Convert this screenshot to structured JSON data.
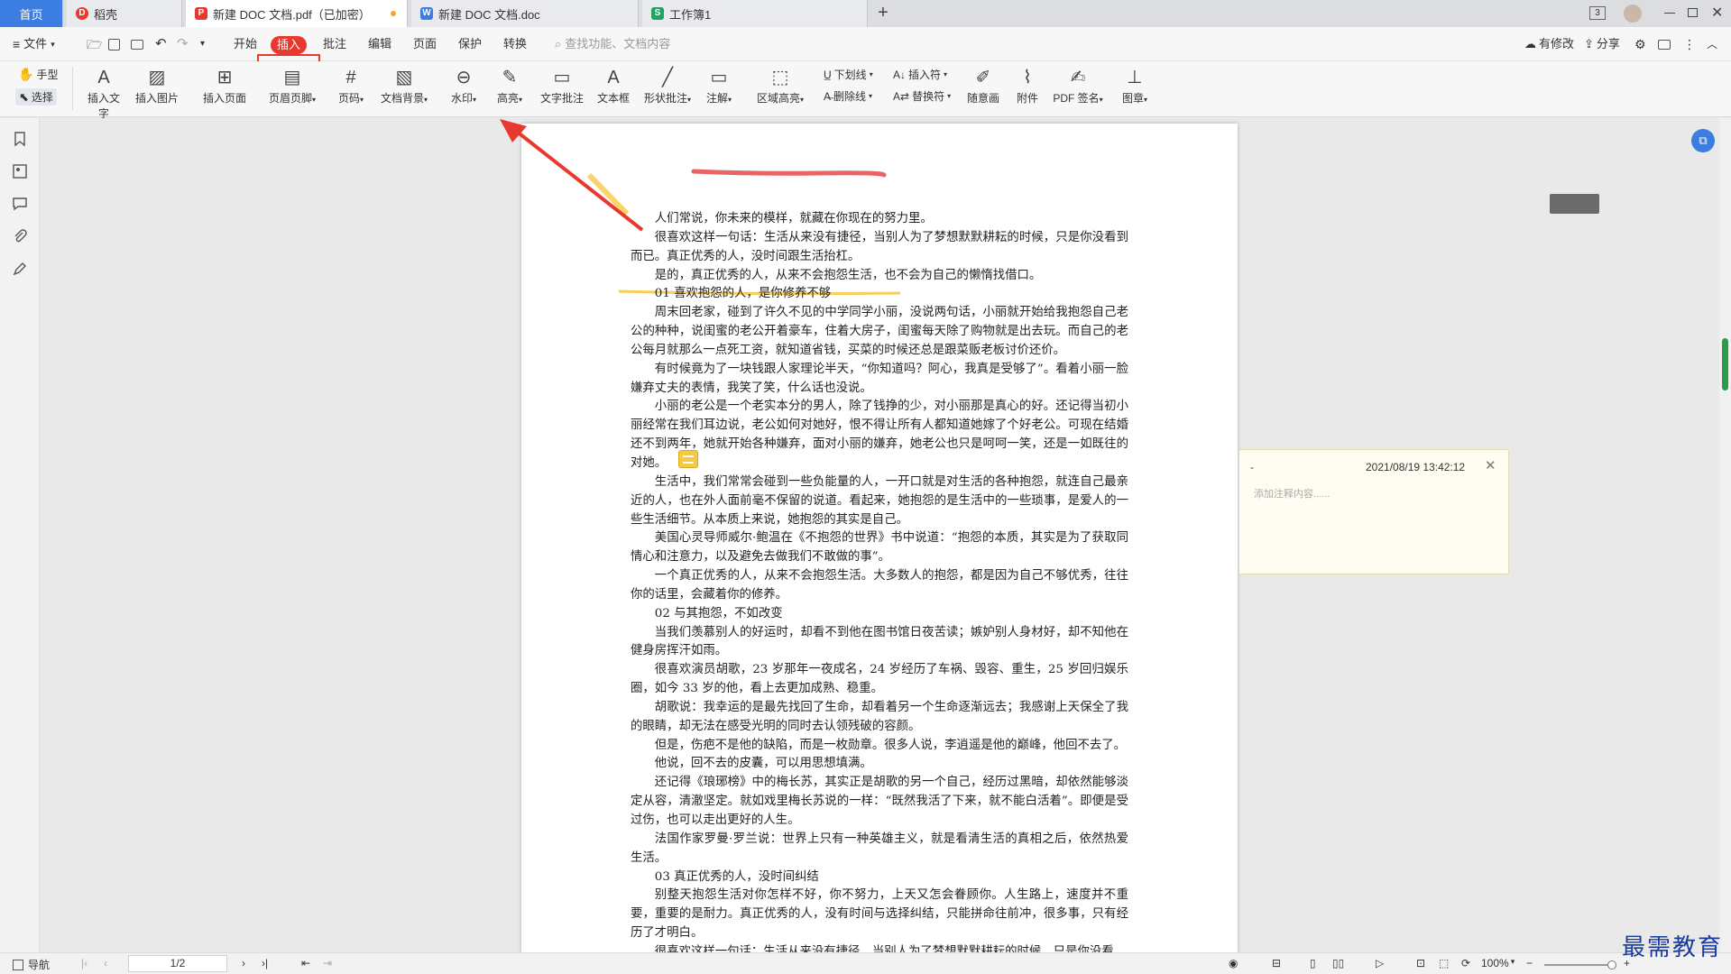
{
  "tabs": [
    {
      "label": "首页",
      "icon": "home-icon"
    },
    {
      "label": "稻壳",
      "icon": "docer-icon"
    },
    {
      "label": "新建 DOC 文档.pdf（已加密）",
      "icon": "pdf-icon"
    },
    {
      "label": "新建 DOC 文档.doc",
      "icon": "word-icon"
    },
    {
      "label": "工作簿1",
      "icon": "sheet-icon"
    }
  ],
  "tabbar": {
    "add_label": "+",
    "page_count": "3"
  },
  "menu": {
    "file": "文件",
    "items": [
      "开始",
      "插入",
      "批注",
      "编辑",
      "页面",
      "保护",
      "转换"
    ],
    "search_placeholder": "查找功能、文档内容",
    "modified": "有修改",
    "share": "分享"
  },
  "toolbar": {
    "hand": "手型",
    "select": "选择",
    "big": [
      "插入文字",
      "插入图片",
      "插入页面",
      "页眉页脚",
      "页码",
      "文档背景",
      "水印",
      "高亮",
      "文字批注",
      "文本框",
      "形状批注",
      "注解",
      "区域高亮"
    ],
    "small_top": [
      "下划线",
      "插入符"
    ],
    "small_bottom": [
      "删除线",
      "替换符"
    ],
    "big2": [
      "随意画",
      "附件",
      "PDF 签名",
      "图章"
    ]
  },
  "document": {
    "paragraphs": [
      {
        "t": "人们常说，你未来的模样，就藏在你现在的努力里。",
        "ind": true
      },
      {
        "t": "很喜欢这样一句话：生活从来没有捷径，当别人为了梦想默默耕耘的时候，只是你没看到而已。真正优秀的人，没时间跟生活抬杠。",
        "ind": true
      },
      {
        "t": "是的，真正优秀的人，从来不会抱怨生活，也不会为自己的懒惰找借口。",
        "ind": true
      },
      {
        "t": "01  喜欢抱怨的人，是你修养不够",
        "ind": true
      },
      {
        "t": "周末回老家，碰到了许久不见的中学同学小丽，没说两句话，小丽就开始给我抱怨自己老公的种种，说闺蜜的老公开着豪车，住着大房子，闺蜜每天除了购物就是出去玩。而自己的老公每月就那么一点死工资，就知道省钱，买菜的时候还总是跟菜贩老板讨价还价。",
        "ind": true
      },
      {
        "t": "有时候竟为了一块钱跟人家理论半天，“你知道吗？阿心，我真是受够了”。看着小丽一脸嫌弃丈夫的表情，我笑了笑，什么话也没说。",
        "ind": true
      },
      {
        "t": "小丽的老公是一个老实本分的男人，除了钱挣的少，对小丽那是真心的好。还记得当初小丽经常在我们耳边说，老公如何对她好，恨不得让所有人都知道她嫁了个好老公。可现在结婚还不到两年，她就开始各种嫌弃，面对小丽的嫌弃，她老公也只是呵呵一笑，还是一如既往的对她。",
        "ind": true
      },
      {
        "t": "生活中，我们常常会碰到一些负能量的人，一开口就是对生活的各种抱怨，就连自己最亲近的人，也在外人面前毫不保留的说道。看起来，她抱怨的是生活中的一些琐事，是爱人的一些生活细节。从本质上来说，她抱怨的其实是自己。",
        "ind": true
      },
      {
        "t": "美国心灵导师威尔·鲍温在《不抱怨的世界》书中说道：“抱怨的本质，其实是为了获取同情心和注意力，以及避免去做我们不敢做的事”。",
        "ind": true
      },
      {
        "t": "一个真正优秀的人，从来不会抱怨生活。大多数人的抱怨，都是因为自己不够优秀，往往你的话里，会藏着你的修养。",
        "ind": true
      },
      {
        "t": "02  与其抱怨，不如改变",
        "ind": true
      },
      {
        "t": "当我们羡慕别人的好运时，却看不到他在图书馆日夜苦读；嫉妒别人身材好，却不知他在健身房挥汗如雨。",
        "ind": true
      },
      {
        "t": "很喜欢演员胡歌，23 岁那年一夜成名，24 岁经历了车祸、毁容、重生，25 岁回归娱乐圈，如今 33 岁的他，看上去更加成熟、稳重。",
        "ind": true
      },
      {
        "t": "胡歌说：我幸运的是最先找回了生命，却看着另一个生命逐渐远去；我感谢上天保全了我的眼睛，却无法在感受光明的同时去认领残破的容颜。",
        "ind": true
      },
      {
        "t": "但是，伤疤不是他的缺陷，而是一枚勋章。很多人说，李逍遥是他的巅峰，他回不去了。",
        "ind": true
      },
      {
        "t": "他说，回不去的皮囊，可以用思想填满。",
        "ind": true
      },
      {
        "t": "还记得《琅琊榜》中的梅长苏，其实正是胡歌的另一个自己，经历过黑暗，却依然能够淡定从容，清澈坚定。就如戏里梅长苏说的一样：“既然我活了下来，就不能白活着”。即便是受过伤，也可以走出更好的人生。",
        "ind": true
      },
      {
        "t": "法国作家罗曼·罗兰说：世界上只有一种英雄主义，就是看清生活的真相之后，依然热爱生活。",
        "ind": true
      },
      {
        "t": "03  真正优秀的人，没时间纠结",
        "ind": true
      },
      {
        "t": "别整天抱怨生活对你怎样不好，你不努力，上天又怎会眷顾你。人生路上，速度并不重要，重要的是耐力。真正优秀的人，没有时间与选择纠结，只能拼命往前冲，很多事，只有经历了才明白。",
        "ind": true
      },
      {
        "t": "很喜欢这样一句话：生活从来没有捷径，当别人为了梦想默默耕耘的时候，只是你没看",
        "ind": true
      }
    ]
  },
  "comment": {
    "author": "-",
    "timestamp": "2021/08/19 13:42:12",
    "placeholder": "添加注释内容......"
  },
  "status": {
    "nav": "导航",
    "page": "1/2",
    "zoom": "100%"
  },
  "watermark_brand": "最需教育",
  "colors": {
    "accent": "#e8382f",
    "highlight_yellow": "#f6c945",
    "ink_red": "#e34a4a",
    "tab_active": "#ffffff",
    "tab_home": "#3b7de0"
  }
}
